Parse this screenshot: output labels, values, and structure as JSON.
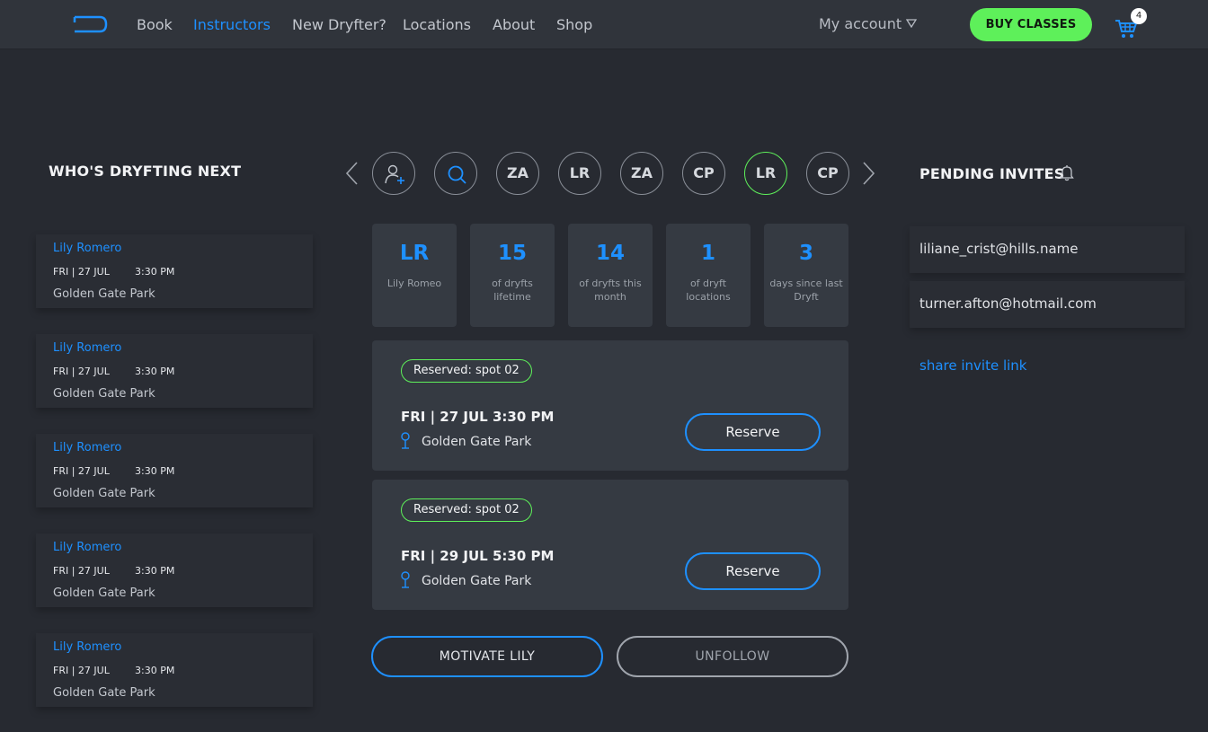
{
  "nav": {
    "links": [
      "Book",
      "Instructors",
      "New Dryfter?",
      "Locations",
      "About",
      "Shop"
    ],
    "active": "Instructors",
    "account_label": "My account",
    "buy_label": "BUY CLASSES",
    "cart_count": "4"
  },
  "who": {
    "title": "WHO'S DRYFTING NEXT",
    "items": [
      {
        "name": "Lily Romero",
        "date": "FRI | 27 JUL",
        "time": "3:30 PM",
        "location": "Golden Gate Park"
      },
      {
        "name": "Lily Romero",
        "date": "FRI | 27 JUL",
        "time": "3:30 PM",
        "location": "Golden Gate Park"
      },
      {
        "name": "Lily Romero",
        "date": "FRI | 27 JUL",
        "time": "3:30 PM",
        "location": "Golden Gate Park"
      },
      {
        "name": "Lily Romero",
        "date": "FRI | 27 JUL",
        "time": "3:30 PM",
        "location": "Golden Gate Park"
      },
      {
        "name": "Lily Romero",
        "date": "FRI | 27 JUL",
        "time": "3:30 PM",
        "location": "Golden Gate Park"
      }
    ]
  },
  "avatars": [
    "ZA",
    "LR",
    "ZA",
    "CP",
    "LR",
    "CP"
  ],
  "stats": [
    {
      "value": "LR",
      "label": "Lily Romeo"
    },
    {
      "value": "15",
      "label": "of dryfts lifetime"
    },
    {
      "value": "14",
      "label": "of dryfts this month"
    },
    {
      "value": "1",
      "label": "of dryft locations"
    },
    {
      "value": "3",
      "label": "days since last Dryft"
    }
  ],
  "reservations": [
    {
      "badge": "Reserved: spot 02",
      "date": "FRI | 27 JUL",
      "time": "3:30 PM",
      "location": "Golden Gate Park",
      "button": "Reserve"
    },
    {
      "badge": "Reserved: spot 02",
      "date": "FRI | 29 JUL",
      "time": "5:30 PM",
      "location": "Golden Gate Park",
      "button": "Reserve"
    }
  ],
  "actions": {
    "motivate": "MOTIVATE LILY",
    "unfollow": "UNFOLLOW"
  },
  "pending": {
    "title": "PENDING INVITES",
    "emails": [
      "liliane_crist@hills.name",
      "turner.afton@hotmail.com"
    ],
    "share_label": "share invite link"
  },
  "colors": {
    "accent": "#1e90ff",
    "success": "#5ef05a",
    "background": "#272a31",
    "card": "#353a42"
  }
}
